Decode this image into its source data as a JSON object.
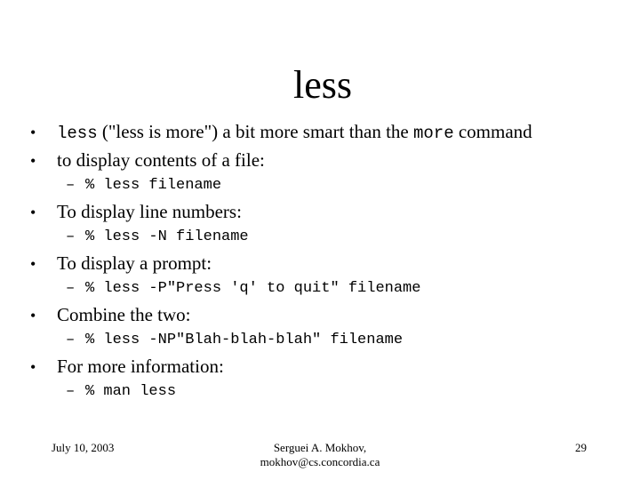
{
  "slide": {
    "title": "less",
    "bullets": [
      {
        "parts": [
          {
            "text": "less",
            "mono": true
          },
          {
            "text": " (\"less is more\") a bit more smart than the ",
            "mono": false
          },
          {
            "text": "more",
            "mono": true
          },
          {
            "text": " command",
            "mono": false
          }
        ]
      },
      {
        "text": "to display contents of a file:",
        "sub": "% less filename"
      },
      {
        "text": "To display line numbers:",
        "sub": "% less -N filename"
      },
      {
        "text": "To display a prompt:",
        "sub": "% less -P\"Press 'q' to quit\" filename"
      },
      {
        "text": "Combine the two:",
        "sub": "% less -NP\"Blah-blah-blah\" filename"
      },
      {
        "text": "For more information:",
        "sub": "% man less"
      }
    ],
    "bullet_glyph": "•",
    "dash_glyph": "–"
  },
  "footer": {
    "date": "July 10, 2003",
    "author": "Serguei A. Mokhov,",
    "email": "mokhov@cs.concordia.ca",
    "page_number": "29"
  }
}
